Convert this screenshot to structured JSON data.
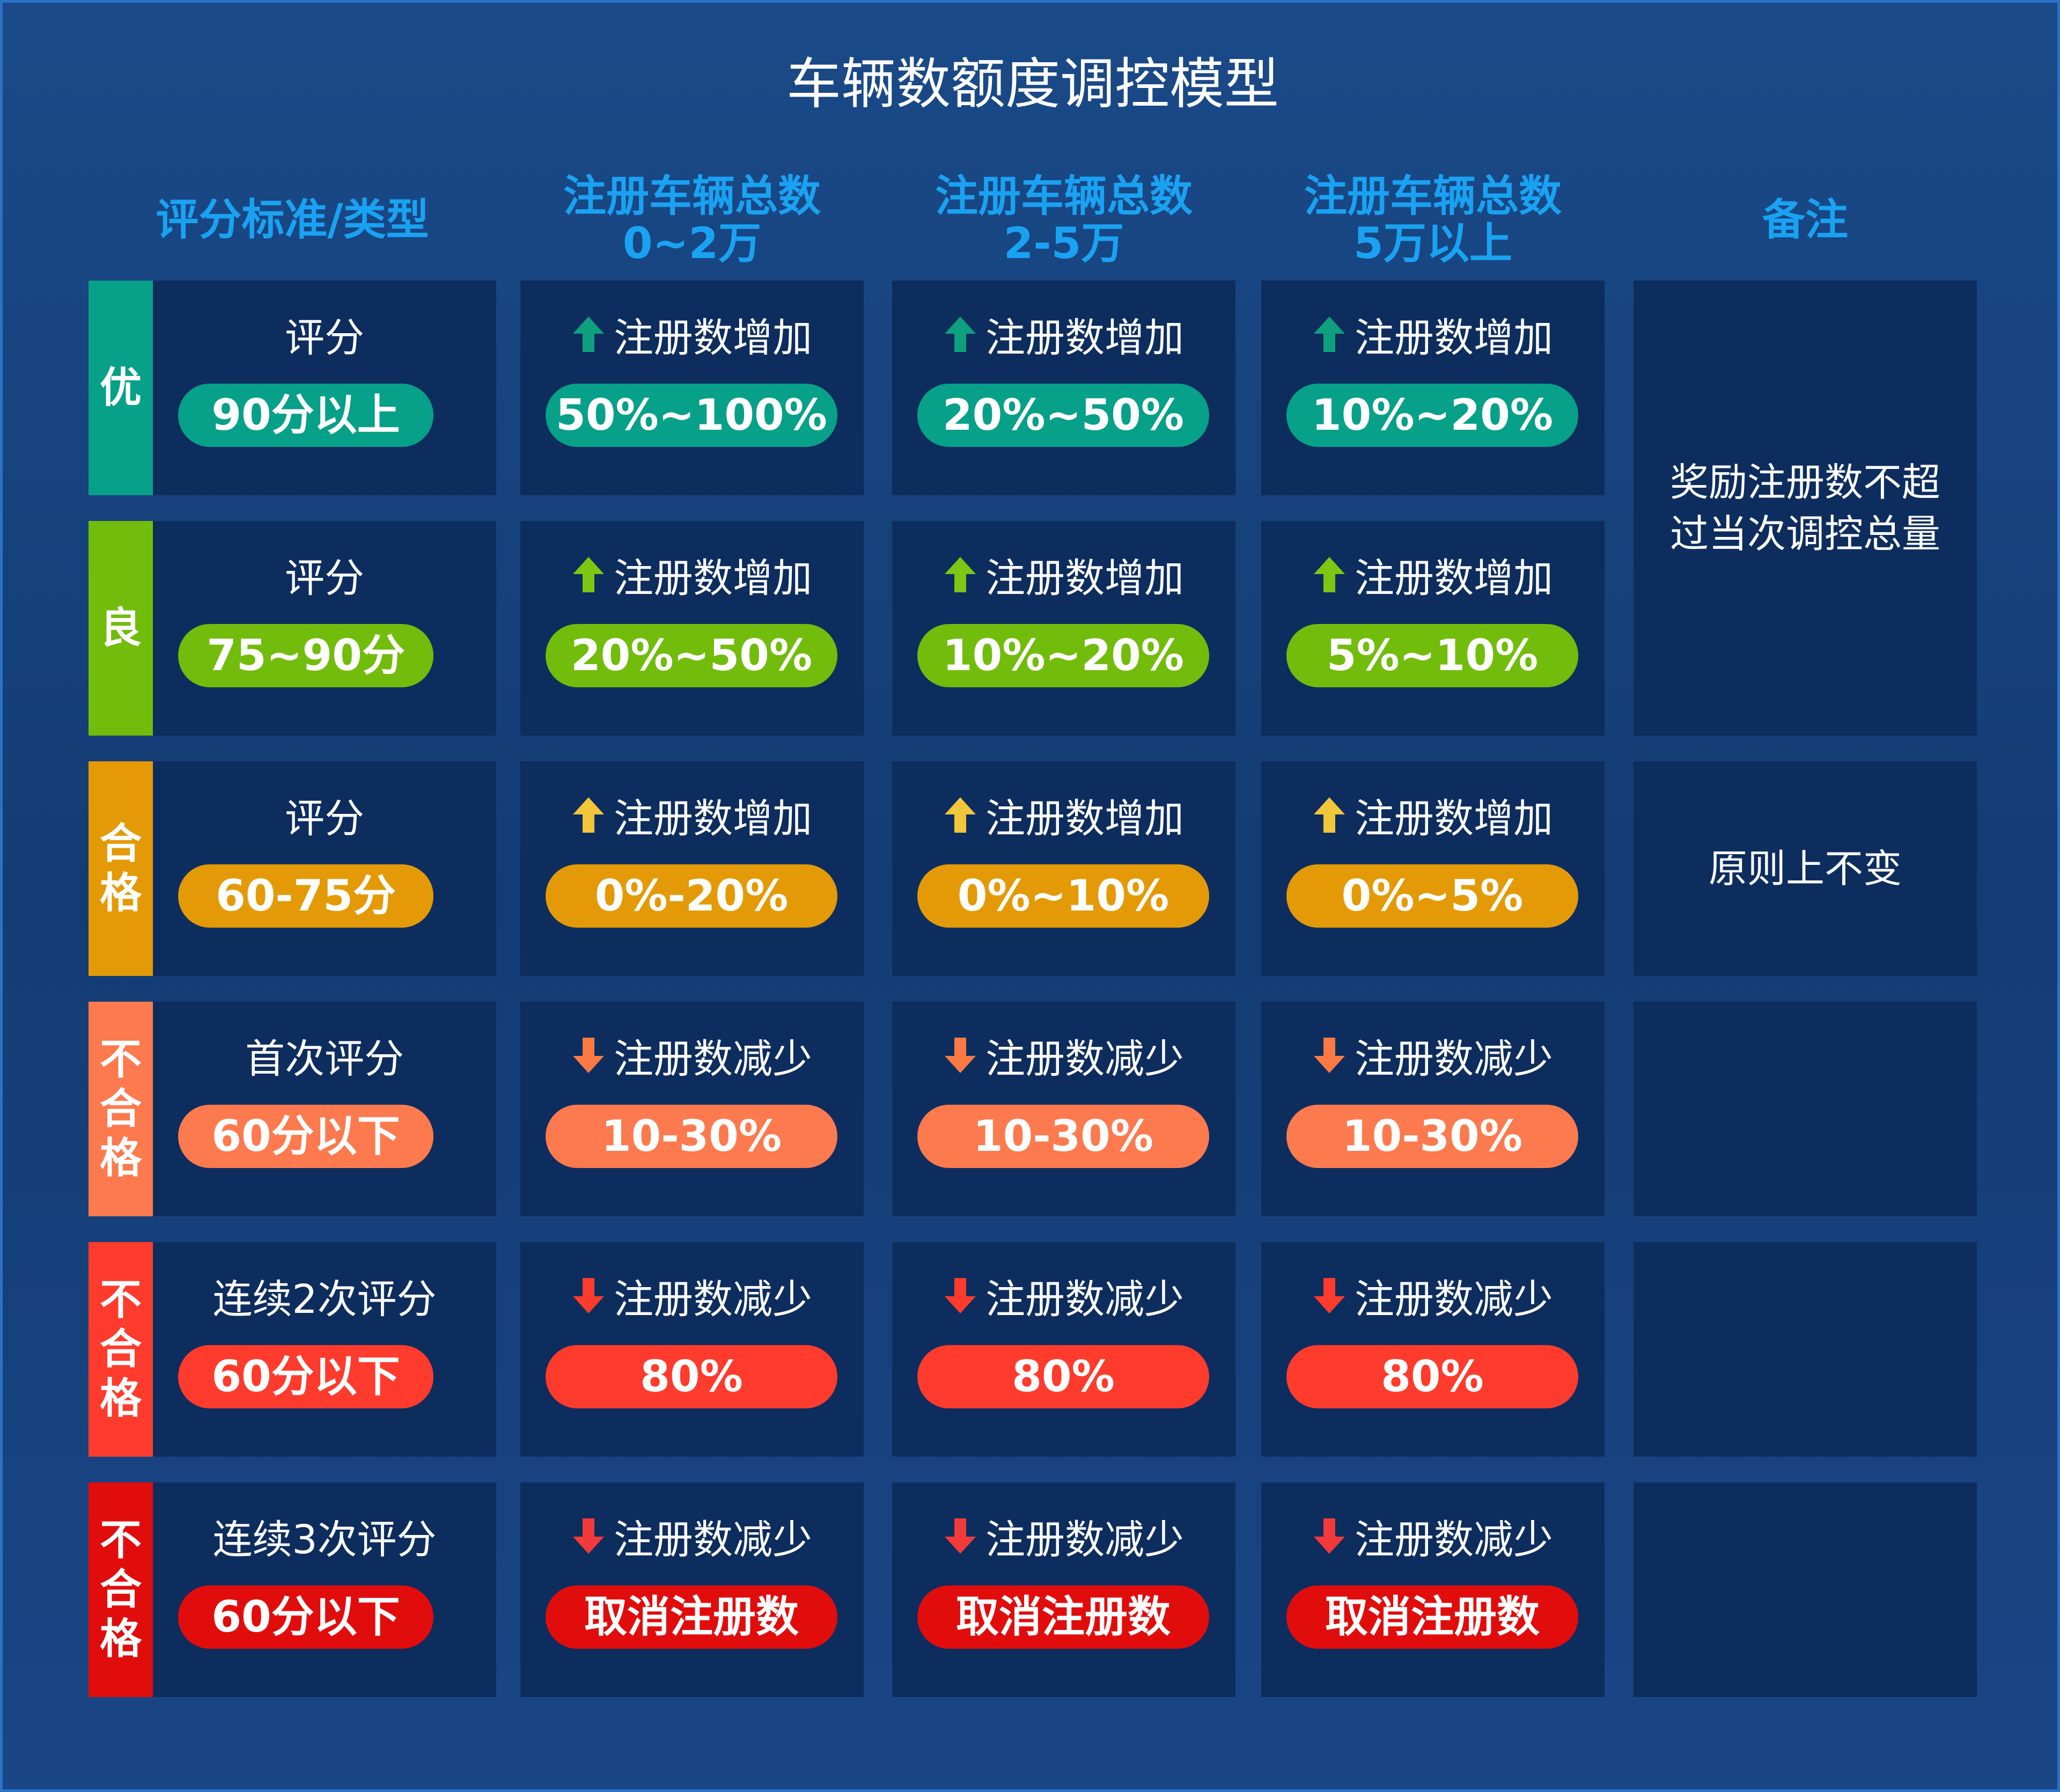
{
  "title": "车辆数额度调控模型",
  "headers": {
    "col1": "评分标准/类型",
    "col2": [
      "注册车辆总数",
      "0~2万"
    ],
    "col3": [
      "注册车辆总数",
      "2-5万"
    ],
    "col4": [
      "注册车辆总数",
      "5万以上"
    ],
    "col5": "备注"
  },
  "colors": {
    "excellent": "#07a088",
    "good": "#72bc0c",
    "pass": "#e49a06",
    "fail1": "#fd7a4e",
    "fail2": "#fe3b2c",
    "fail3": "#e10d0d"
  },
  "rows": [
    {
      "tag": [
        "优"
      ],
      "color": "#07a088",
      "arrow_color": "#0fa07e",
      "direction": "up",
      "score_label": "评分",
      "score": "90分以上",
      "values": [
        {
          "label": "注册数增加",
          "value": "50%~100%"
        },
        {
          "label": "注册数增加",
          "value": "20%~50%"
        },
        {
          "label": "注册数增加",
          "value": "10%~20%"
        }
      ]
    },
    {
      "tag": [
        "良"
      ],
      "color": "#72bc0c",
      "arrow_color": "#7cc614",
      "direction": "up",
      "score_label": "评分",
      "score": "75~90分",
      "values": [
        {
          "label": "注册数增加",
          "value": "20%~50%"
        },
        {
          "label": "注册数增加",
          "value": "10%~20%"
        },
        {
          "label": "注册数增加",
          "value": "5%~10%"
        }
      ]
    },
    {
      "tag": [
        "合",
        "格"
      ],
      "color": "#e49a06",
      "arrow_color": "#f2c63a",
      "direction": "up",
      "score_label": "评分",
      "score": "60-75分",
      "values": [
        {
          "label": "注册数增加",
          "value": "0%-20%"
        },
        {
          "label": "注册数增加",
          "value": "0%~10%"
        },
        {
          "label": "注册数增加",
          "value": "0%~5%"
        }
      ]
    },
    {
      "tag": [
        "不",
        "合",
        "格"
      ],
      "color": "#fd7a4e",
      "arrow_color": "#fb7a44",
      "direction": "down",
      "score_label": "首次评分",
      "score": "60分以下",
      "values": [
        {
          "label": "注册数减少",
          "value": "10-30%"
        },
        {
          "label": "注册数减少",
          "value": "10-30%"
        },
        {
          "label": "注册数减少",
          "value": "10-30%"
        }
      ]
    },
    {
      "tag": [
        "不",
        "合",
        "格"
      ],
      "color": "#fe3b2c",
      "arrow_color": "#fe3b2c",
      "direction": "down",
      "score_label": "连续2次评分",
      "score": "60分以下",
      "values": [
        {
          "label": "注册数减少",
          "value": "80%"
        },
        {
          "label": "注册数减少",
          "value": "80%"
        },
        {
          "label": "注册数减少",
          "value": "80%"
        }
      ]
    },
    {
      "tag": [
        "不",
        "合",
        "格"
      ],
      "color": "#e10d0d",
      "arrow_color": "#f23a3a",
      "direction": "down",
      "score_label": "连续3次评分",
      "score": "60分以下",
      "values": [
        {
          "label": "注册数减少",
          "value": "取消注册数"
        },
        {
          "label": "注册数减少",
          "value": "取消注册数"
        },
        {
          "label": "注册数减少",
          "value": "取消注册数"
        }
      ]
    }
  ],
  "notes": [
    {
      "lines": [
        "奖励注册数不超",
        "过当次调控总量"
      ]
    },
    {
      "lines": [
        "原则上不变"
      ]
    }
  ]
}
